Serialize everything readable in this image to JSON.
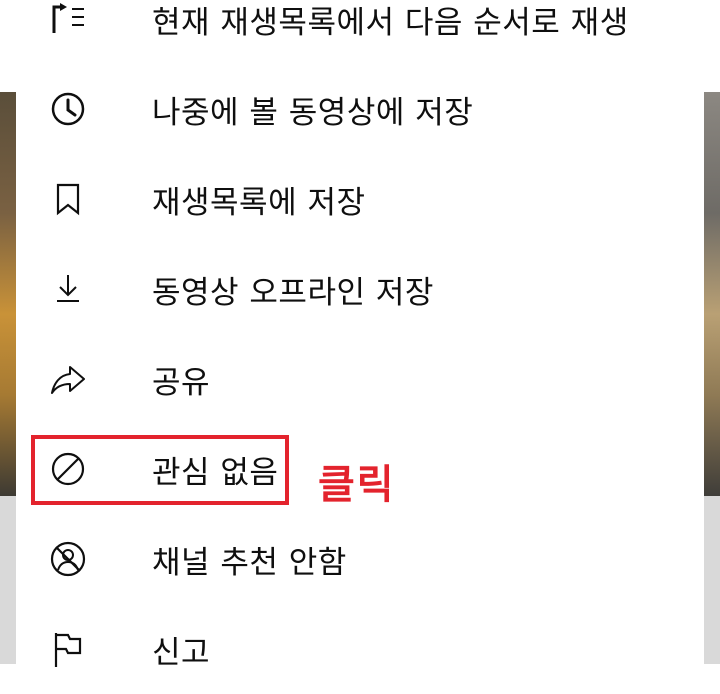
{
  "menu": {
    "items": [
      {
        "icon": "play-next-icon",
        "label": "현재 재생목록에서 다음 순서로 재생"
      },
      {
        "icon": "clock-icon",
        "label": "나중에 볼 동영상에 저장"
      },
      {
        "icon": "bookmark-icon",
        "label": "재생목록에 저장"
      },
      {
        "icon": "download-icon",
        "label": "동영상 오프라인 저장"
      },
      {
        "icon": "share-icon",
        "label": "공유"
      },
      {
        "icon": "not-interested-icon",
        "label": "관심 없음"
      },
      {
        "icon": "block-channel-icon",
        "label": "채널 추천 안함"
      },
      {
        "icon": "flag-icon",
        "label": "신고"
      }
    ]
  },
  "annotation": {
    "text": "클릭",
    "color": "#e3232d"
  }
}
